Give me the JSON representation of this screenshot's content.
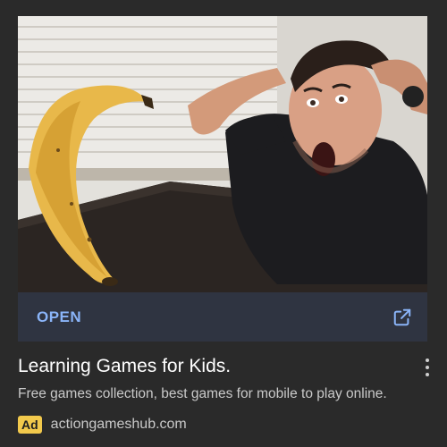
{
  "ad": {
    "open_label": "OPEN",
    "title": "Learning Games for Kids.",
    "description": "Free games collection, best games for mobile to play online.",
    "badge": "Ad",
    "domain": "actiongameshub.com",
    "image_subject": "surprised man looking at banana on table",
    "icons": {
      "open": "external-link-icon",
      "menu": "more-vertical-icon"
    }
  },
  "colors": {
    "background": "#2a2a2a",
    "open_bar": "#2f3441",
    "accent": "#8ab4f8",
    "badge": "#f2c94c"
  }
}
